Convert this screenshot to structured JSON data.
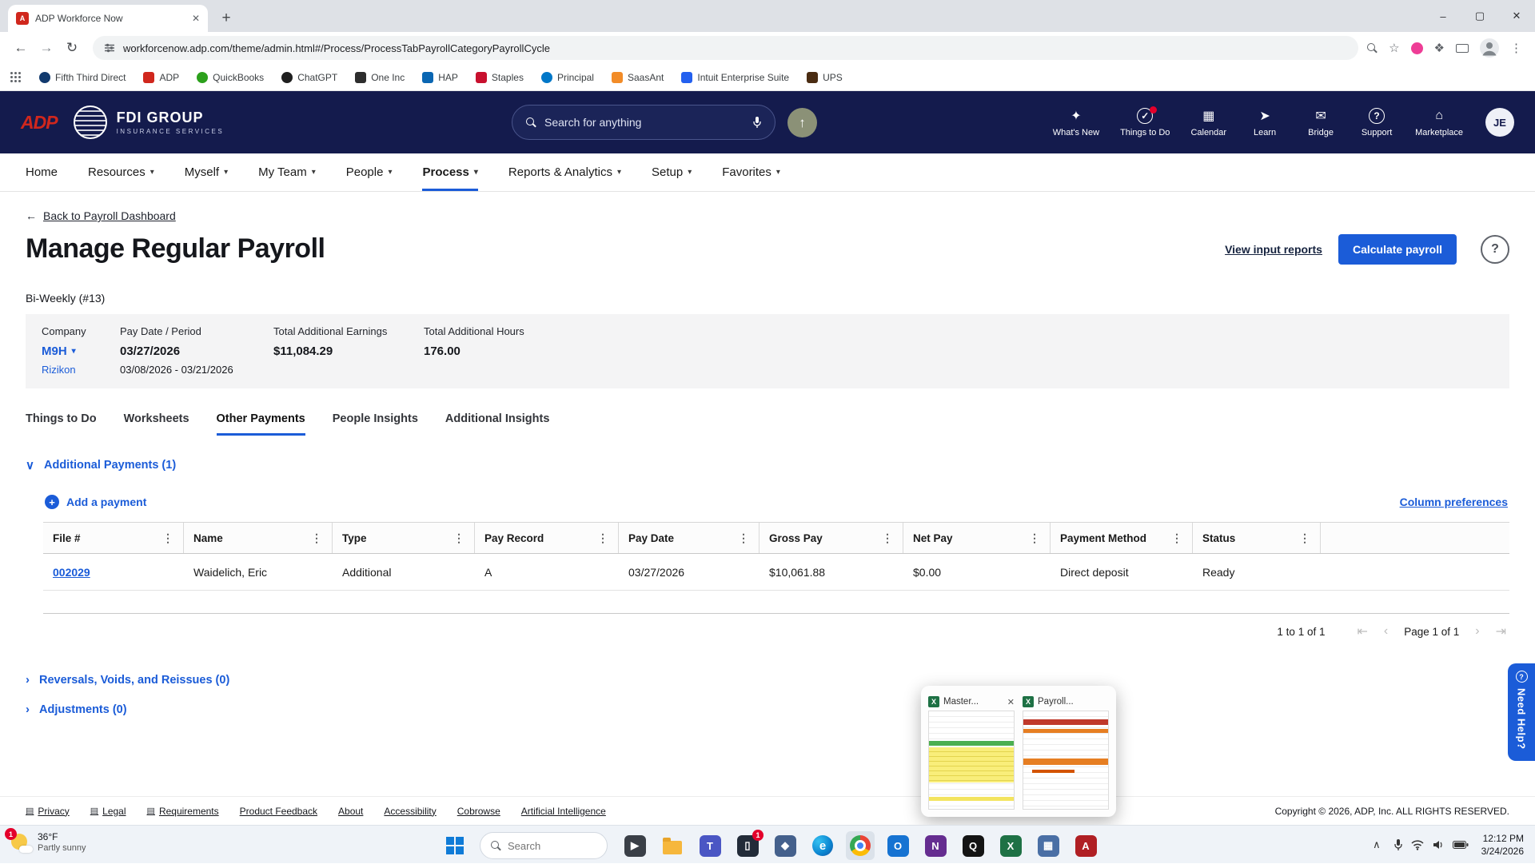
{
  "icons": {
    "close": "✕",
    "min": "–",
    "max": "▢",
    "newtab": "+",
    "back": "←",
    "fwd": "→",
    "reload": "↻",
    "star": "☆",
    "ext": "❖",
    "kebab": "⋮",
    "caret": "▾",
    "chev_down": "∨",
    "chev_right": "›",
    "chev_up": "∧",
    "up": "↑",
    "plus": "+",
    "question": "?",
    "first": "⇤",
    "prev": "‹",
    "next": "›",
    "last": "⇥",
    "doc": "▤"
  },
  "browser": {
    "tab_title": "ADP Workforce Now",
    "favicon_letter": "A",
    "url": "workforcenow.adp.com/theme/admin.html#/Process/ProcessTabPayrollCategoryPayrollCycle",
    "bookmarks": [
      {
        "label": "Fifth Third Direct",
        "style": "background:#123a6e;border-radius:50%"
      },
      {
        "label": "ADP",
        "style": "background:#d0271d"
      },
      {
        "label": "QuickBooks",
        "style": "background:#2ca01c;border-radius:50%"
      },
      {
        "label": "ChatGPT",
        "style": "background:#1f1f1f;border-radius:50%"
      },
      {
        "label": "One Inc",
        "style": "background:#2d2d2d"
      },
      {
        "label": "HAP",
        "style": "background:#0a66b2"
      },
      {
        "label": "Staples",
        "style": "background:#c8102e"
      },
      {
        "label": "Principal",
        "style": "background:#0077c8;border-radius:50%"
      },
      {
        "label": "SaasAnt",
        "style": "background:#f28c28"
      },
      {
        "label": "Intuit Enterprise Suite",
        "style": "background:#2360ef"
      },
      {
        "label": "UPS",
        "style": "background:#4a2c12"
      }
    ]
  },
  "header": {
    "logo_text": "ADP",
    "brand_name": "FDI GROUP",
    "brand_sub": "INSURANCE SERVICES",
    "search_placeholder": "Search for anything",
    "actions": [
      {
        "label": "What's New",
        "glyph": "✦"
      },
      {
        "label": "Things to Do",
        "glyph": "✓"
      },
      {
        "label": "Calendar",
        "glyph": "▦"
      },
      {
        "label": "Learn",
        "glyph": "➤"
      },
      {
        "label": "Bridge",
        "glyph": "✉"
      },
      {
        "label": "Support",
        "glyph": "?"
      },
      {
        "label": "Marketplace",
        "glyph": "⌂"
      }
    ],
    "avatar": "JE"
  },
  "nav": {
    "items": [
      "Home",
      "Resources",
      "Myself",
      "My Team",
      "People",
      "Process",
      "Reports & Analytics",
      "Setup",
      "Favorites"
    ]
  },
  "page": {
    "back_link": "Back to Payroll Dashboard",
    "title": "Manage Regular Payroll",
    "view_reports": "View input reports",
    "calculate": "Calculate payroll",
    "cycle": "Bi-Weekly (#13)",
    "summary": {
      "company_label": "Company",
      "company_code": "M9H",
      "company_name": "Rizikon",
      "pay_date_label": "Pay Date / Period",
      "pay_date": "03/27/2026",
      "pay_period": "03/08/2026 - 03/21/2026",
      "earnings_label": "Total Additional Earnings",
      "earnings": "$11,084.29",
      "hours_label": "Total Additional Hours",
      "hours": "176.00"
    },
    "tabs": [
      "Things to Do",
      "Worksheets",
      "Other Payments",
      "People Insights",
      "Additional Insights"
    ],
    "sections": {
      "additional": "Additional Payments (1)",
      "reversals": "Reversals, Voids, and Reissues (0)",
      "adjustments": "Adjustments (0)"
    },
    "add_payment": "Add a payment",
    "column_prefs": "Column preferences",
    "table": {
      "columns": [
        "File #",
        "Name",
        "Type",
        "Pay Record",
        "Pay Date",
        "Gross Pay",
        "Net Pay",
        "Payment Method",
        "Status"
      ],
      "row": {
        "file": "002029",
        "name": "Waidelich, Eric",
        "type": "Additional",
        "pay_record": "A",
        "pay_date": "03/27/2026",
        "gross": "$10,061.88",
        "net": "$0.00",
        "method": "Direct deposit",
        "status": "Ready"
      }
    },
    "pager": {
      "range": "1 to 1 of 1",
      "page": "Page 1 of 1"
    }
  },
  "popup": {
    "cards": [
      {
        "label": "Master..."
      },
      {
        "label": "Payroll..."
      }
    ],
    "excel_glyph": "X"
  },
  "need_help": "Need Help?",
  "footer": {
    "links": [
      {
        "label": "Privacy"
      },
      {
        "label": "Legal"
      },
      {
        "label": "Requirements"
      },
      {
        "label": "Product Feedback"
      },
      {
        "label": "About"
      },
      {
        "label": "Accessibility"
      },
      {
        "label": "Cobrowse"
      },
      {
        "label": "Artificial Intelligence"
      }
    ],
    "copyright": "Copyright © 2026, ADP, Inc. ALL RIGHTS RESERVED."
  },
  "taskbar": {
    "weather_temp": "36°F",
    "weather_desc": "Partly sunny",
    "weather_badge": "1",
    "search_placeholder": "Search",
    "apps": [
      {
        "name": "media-app",
        "glyph": "▶",
        "style": "background:#3a3f47"
      },
      {
        "name": "file-explorer",
        "glyph": "",
        "style": ""
      },
      {
        "name": "teams",
        "glyph": "T",
        "style": "background:#4a56c4"
      },
      {
        "name": "phone-link",
        "glyph": "▯",
        "style": "background:#222b38",
        "badge": "1"
      },
      {
        "name": "pinned-app",
        "glyph": "◆",
        "style": "background:#44608c"
      },
      {
        "name": "edge",
        "glyph": "e",
        "style": ""
      },
      {
        "name": "chrome",
        "glyph": "",
        "style": ""
      },
      {
        "name": "outlook",
        "glyph": "O",
        "style": "background:#1673d2"
      },
      {
        "name": "onenote",
        "glyph": "N",
        "style": "background:#652d90"
      },
      {
        "name": "quick-app",
        "glyph": "Q",
        "style": "background:#141414"
      },
      {
        "name": "excel",
        "glyph": "X",
        "style": "background:#1e7145"
      },
      {
        "name": "calculator",
        "glyph": "▦",
        "style": "background:#4a6fa5"
      },
      {
        "name": "acrobat",
        "glyph": "A",
        "style": "background:#b01f24"
      }
    ],
    "time": "12:12 PM",
    "date": "3/24/2026"
  }
}
